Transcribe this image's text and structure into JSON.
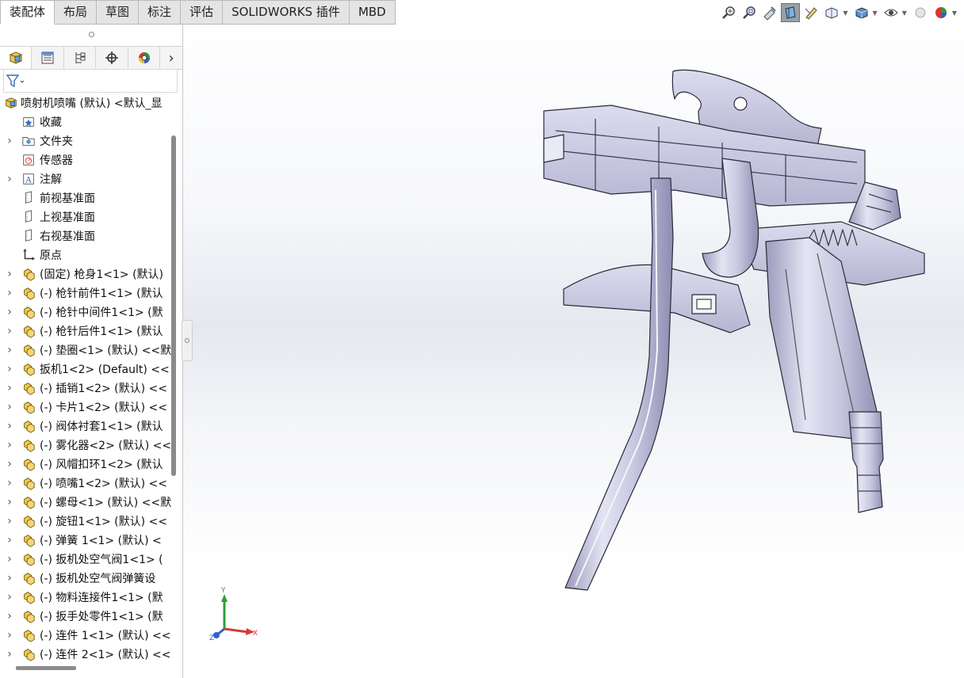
{
  "tabs": [
    "装配体",
    "布局",
    "草图",
    "标注",
    "评估",
    "SOLIDWORKS 插件",
    "MBD"
  ],
  "active_tab": "装配体",
  "tree": {
    "root": "喷射机喷嘴 (默认) <默认_显",
    "items": [
      {
        "label": "收藏",
        "icon": "favorites-icon",
        "expander": false
      },
      {
        "label": "文件夹",
        "icon": "folder-icon",
        "expander": true
      },
      {
        "label": "传感器",
        "icon": "sensor-icon",
        "expander": false
      },
      {
        "label": "注解",
        "icon": "annotation-icon",
        "expander": true
      },
      {
        "label": "前视基准面",
        "icon": "plane-icon",
        "expander": false
      },
      {
        "label": "上视基准面",
        "icon": "plane-icon",
        "expander": false
      },
      {
        "label": "右视基准面",
        "icon": "plane-icon",
        "expander": false
      },
      {
        "label": "原点",
        "icon": "origin-icon",
        "expander": false
      },
      {
        "label": "(固定) 枪身1<1> (默认)",
        "icon": "part-icon",
        "expander": true
      },
      {
        "label": "(-) 枪针前件1<1> (默认",
        "icon": "part-icon",
        "expander": true
      },
      {
        "label": "(-) 枪针中间件1<1> (默",
        "icon": "part-icon",
        "expander": true
      },
      {
        "label": "(-) 枪针后件1<1> (默认",
        "icon": "part-icon",
        "expander": true
      },
      {
        "label": "(-) 垫圈<1> (默认) <<默",
        "icon": "part-icon",
        "expander": true
      },
      {
        "label": "扳机1<2> (Default) <<",
        "icon": "part-icon",
        "expander": true
      },
      {
        "label": "(-) 插销1<2> (默认) <<",
        "icon": "part-icon",
        "expander": true
      },
      {
        "label": "(-) 卡片1<2> (默认) <<",
        "icon": "part-icon",
        "expander": true
      },
      {
        "label": "(-) 阀体衬套1<1> (默认",
        "icon": "part-icon",
        "expander": true
      },
      {
        "label": "(-) 雾化器<2> (默认) <<",
        "icon": "part-icon",
        "expander": true
      },
      {
        "label": "(-) 风帽扣环1<2> (默认",
        "icon": "part-icon",
        "expander": true
      },
      {
        "label": "(-) 喷嘴1<2> (默认) <<",
        "icon": "part-icon",
        "expander": true
      },
      {
        "label": "(-) 螺母<1> (默认) <<默",
        "icon": "part-icon",
        "expander": true
      },
      {
        "label": "(-) 旋钮1<1> (默认) <<",
        "icon": "part-icon",
        "expander": true
      },
      {
        "label": "(-) 弹簧   1<1> (默认) <",
        "icon": "part-icon",
        "expander": true
      },
      {
        "label": "(-) 扳机处空气阀1<1> (",
        "icon": "part-icon",
        "expander": true
      },
      {
        "label": "(-) 扳机处空气阀弹簧设",
        "icon": "part-icon",
        "expander": true
      },
      {
        "label": "(-) 物料连接件1<1> (默",
        "icon": "part-icon",
        "expander": true
      },
      {
        "label": "(-) 扳手处零件1<1> (默",
        "icon": "part-icon",
        "expander": true
      },
      {
        "label": "(-) 连件 1<1> (默认) <<",
        "icon": "part-icon",
        "expander": true
      },
      {
        "label": "(-) 连件 2<1> (默认) <<",
        "icon": "part-icon",
        "expander": true
      }
    ]
  },
  "triad": {
    "x": "X",
    "y": "Y",
    "z": "Z"
  },
  "heads_up_toolbar": [
    "zoom-to-fit-icon",
    "zoom-to-area-icon",
    "previous-view-icon",
    "section-view-icon",
    "dynamic-annotation-icon",
    "view-orientation-icon",
    "display-style-icon",
    "hide-show-icon",
    "edit-appearance-icon",
    "apply-scene-icon"
  ]
}
